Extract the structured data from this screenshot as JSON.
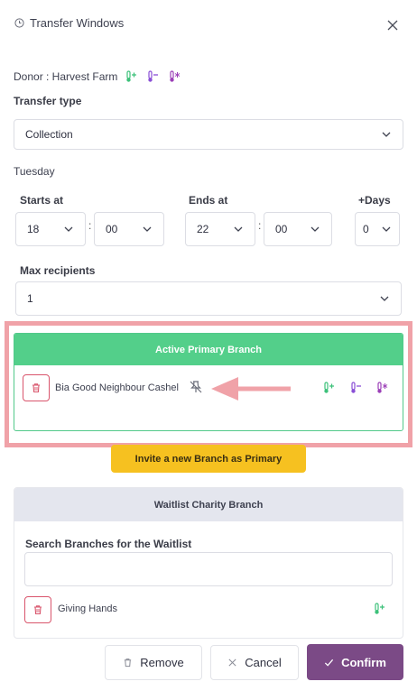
{
  "header": {
    "title": "Transfer Windows"
  },
  "donor": {
    "label": "Donor : Harvest Farm"
  },
  "transfer_type": {
    "label": "Transfer type",
    "value": "Collection"
  },
  "day": "Tuesday",
  "time": {
    "starts_label": "Starts at",
    "ends_label": "Ends at",
    "days_label": "+Days",
    "start_hour": "18",
    "start_minute": "00",
    "end_hour": "22",
    "end_minute": "00",
    "separator": ":",
    "days": "0"
  },
  "max_recipients": {
    "label": "Max recipients",
    "value": "1"
  },
  "primary": {
    "title": "Active Primary Branch",
    "branch_name": "Bia Good Neighbour Cashel"
  },
  "invite_button": "Invite a new Branch as Primary",
  "waitlist": {
    "title": "Waitlist Charity Branch",
    "search_label": "Search Branches for the Waitlist",
    "search_value": "",
    "branch_name": "Giving Hands"
  },
  "footer": {
    "remove": "Remove",
    "cancel": "Cancel",
    "confirm": "Confirm"
  },
  "colors": {
    "green": "#53cf8a",
    "purple": "#7b4a86",
    "yellow": "#f6c120",
    "danger": "#d9556c",
    "highlight": "#f0a2a8"
  },
  "icons": {
    "thermo_warm": "thermometer-plus-icon",
    "thermo_cool": "thermometer-minus-icon",
    "thermo_frozen": "thermometer-snow-icon",
    "unpin": "unpin-icon",
    "trash": "trash-icon",
    "arrow": "left-arrow-annotation"
  }
}
